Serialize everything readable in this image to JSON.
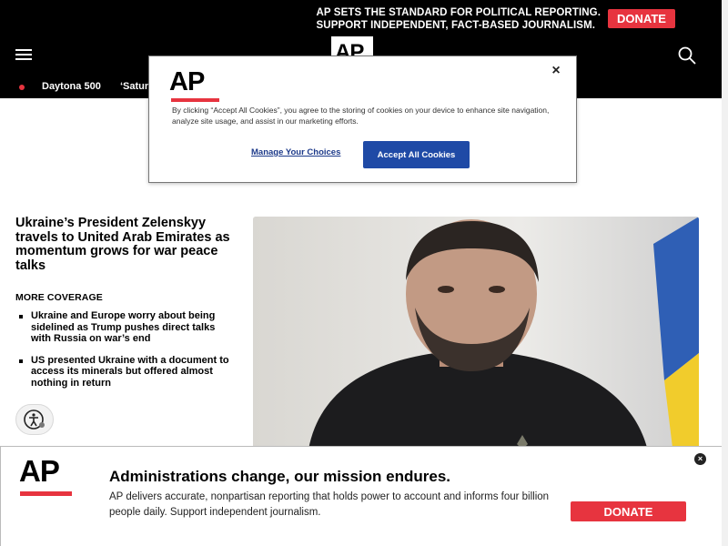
{
  "header": {
    "promo_line1": "AP SETS THE STANDARD FOR POLITICAL REPORTING.",
    "promo_line2": "SUPPORT INDEPENDENT, FACT-BASED JOURNALISM.",
    "donate_label": "DONATE",
    "logo_text": "AP",
    "menu_icon": "hamburger-icon",
    "search_icon": "search-icon"
  },
  "trending": {
    "items": [
      "Daytona 500",
      "‘Satur"
    ]
  },
  "article": {
    "headline": "Ukraine’s President Zelenskyy travels to United Arab Emirates as momentum grows for war peace talks",
    "more_coverage_label": "MORE COVERAGE",
    "coverage": [
      "Ukraine and Europe worry about being sidelined as Trump pushes direct talks with Russia on war’s end",
      "US presented Ukraine with a document to access its minerals but offered almost nothing in return"
    ]
  },
  "cookie_modal": {
    "logo_text": "AP",
    "text": "By clicking “Accept All Cookies”, you agree to the storing of cookies on your device to enhance site navigation, analyze site usage, and assist in our marketing efforts.",
    "manage_label": "Manage Your Choices",
    "accept_label": "Accept All Cookies",
    "close_label": "×"
  },
  "banner": {
    "logo_text": "AP",
    "title": "Administrations change, our mission endures.",
    "body": "AP delivers accurate, nonpartisan reporting that holds power to account and informs four billion people daily. Support independent journalism.",
    "donate_label": "DONATE",
    "close_label": "×"
  },
  "colors": {
    "brand_red": "#e7343f",
    "accept_blue": "#1f4aa6",
    "header_bg": "#000000"
  }
}
